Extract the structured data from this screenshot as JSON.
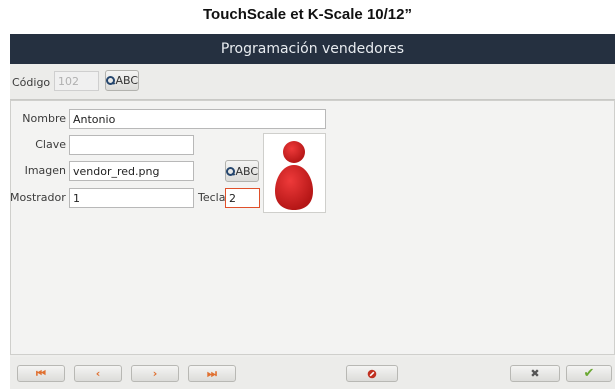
{
  "doc_title": "TouchScale et K-Scale 10/12”",
  "window": {
    "title": "Programación vendedores"
  },
  "header": {
    "codigo_label": "Código",
    "codigo_value": "102",
    "search_button_label": "ABC"
  },
  "form": {
    "nombre_label": "Nombre",
    "nombre_value": "Antonio",
    "clave_label": "Clave",
    "clave_value": "",
    "imagen_label": "Imagen",
    "imagen_value": "vendor_red.png",
    "imagen_button_label": "ABC",
    "mostrador_label": "Mostrador",
    "mostrador_value": "1",
    "tecla_label": "Tecla",
    "tecla_value": "2"
  },
  "icons": {
    "first": "first-icon",
    "prev": "prev-icon",
    "next": "next-icon",
    "last": "last-icon",
    "delete": "delete-icon",
    "cancel": "cancel-icon",
    "accept": "accept-icon",
    "search": "search-icon",
    "avatar": "vendor-avatar-icon"
  },
  "colors": {
    "titlebar": "#253040",
    "nav_accent": "#e07030",
    "delete": "#c03020",
    "accept": "#6aa832",
    "avatar": "#d11f1f"
  }
}
